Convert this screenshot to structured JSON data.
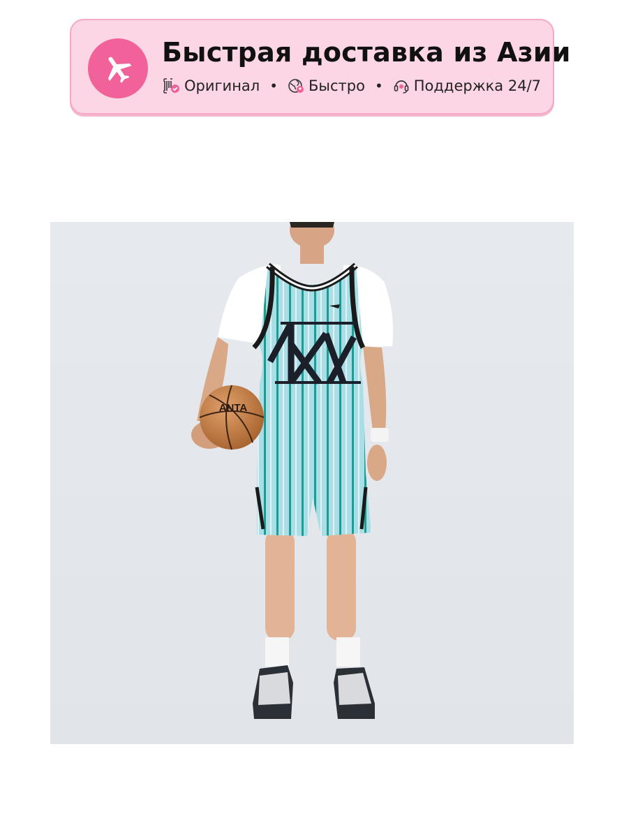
{
  "banner": {
    "title": "Быстрая доставка из Азии",
    "features": [
      {
        "icon": "original-check-icon",
        "label": "Оригинал"
      },
      {
        "icon": "globe-icon",
        "label": "Быстро"
      },
      {
        "icon": "headset-icon",
        "label": "Поддержка 24/7"
      }
    ],
    "separator": "•",
    "colors": {
      "background": "#fcd6e4",
      "accent": "#f2629a",
      "border": "#f6a8c6"
    }
  },
  "product_photo": {
    "alt": "Product photo: basketball jersey and shorts set",
    "ball_brand": "ANTA"
  }
}
